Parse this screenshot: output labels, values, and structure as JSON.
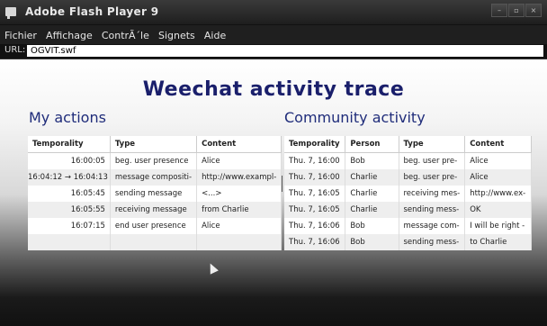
{
  "window": {
    "title": "Adobe Flash Player 9",
    "controls": [
      "–",
      "▫",
      "×"
    ]
  },
  "menu": [
    "Fichier",
    "Affichage",
    "ContrÃ´le",
    "Signets",
    "Aide"
  ],
  "url": {
    "label": "URL:",
    "value": "OGVIT.swf"
  },
  "headline": "Weechat activity trace",
  "my_actions": {
    "title": "My actions",
    "columns": [
      "Temporality",
      "Type",
      "Content"
    ],
    "rows": [
      [
        "16:00:05",
        "beg. user presence",
        "Alice"
      ],
      [
        "16:04:12 → 16:04:13",
        "message compositi-",
        "http://www.exampl-"
      ],
      [
        "16:05:45",
        "sending message",
        "<...>"
      ],
      [
        "16:05:55",
        "receiving message",
        "from Charlie"
      ],
      [
        "16:07:15",
        "end user presence",
        "Alice"
      ],
      [
        "",
        "",
        ""
      ]
    ]
  },
  "community": {
    "title": "Community activity",
    "columns": [
      "Temporality",
      "Person",
      "Type",
      "Content"
    ],
    "rows": [
      [
        "Thu. 7, 16:00",
        "Bob",
        "beg. user pre-",
        "Alice"
      ],
      [
        "Thu. 7, 16:00",
        "Charlie",
        "beg. user pre-",
        "Alice"
      ],
      [
        "Thu. 7, 16:05",
        "Charlie",
        "receiving mes-",
        "http://www.ex-"
      ],
      [
        "Thu. 7, 16:05",
        "Charlie",
        "sending mess-",
        "OK"
      ],
      [
        "Thu. 7, 16:06",
        "Bob",
        "message com-",
        "I will be right -"
      ],
      [
        "Thu. 7, 16:06",
        "Bob",
        "sending mess-",
        "to Charlie"
      ]
    ]
  }
}
